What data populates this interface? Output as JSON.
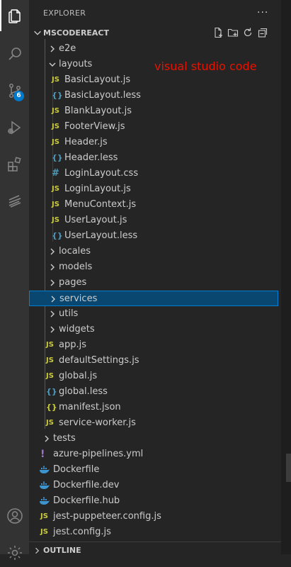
{
  "activity_bar": {
    "items": [
      {
        "name": "explorer-icon",
        "active": true
      },
      {
        "name": "search-icon"
      },
      {
        "name": "source-control-icon",
        "badge": "6"
      },
      {
        "name": "run-debug-icon"
      },
      {
        "name": "extensions-icon"
      },
      {
        "name": "remote-icon"
      },
      {
        "name": "account-icon"
      },
      {
        "name": "manage-gear-icon"
      }
    ]
  },
  "sidebar": {
    "title": "EXPLORER",
    "more": "···",
    "section": "MSCODEREACT",
    "section_actions": [
      "new-file-icon",
      "new-folder-icon",
      "refresh-icon",
      "collapse-all-icon"
    ],
    "annotation": "visual studio code",
    "outline": "OUTLINE"
  },
  "tree": [
    {
      "label": "e2e",
      "type": "folder",
      "expanded": false,
      "depth": 1
    },
    {
      "label": "layouts",
      "type": "folder",
      "expanded": true,
      "depth": 1
    },
    {
      "label": "BasicLayout.js",
      "type": "js",
      "depth": 2
    },
    {
      "label": "BasicLayout.less",
      "type": "less",
      "depth": 2
    },
    {
      "label": "BlankLayout.js",
      "type": "js",
      "depth": 2
    },
    {
      "label": "FooterView.js",
      "type": "js",
      "depth": 2
    },
    {
      "label": "Header.js",
      "type": "js",
      "depth": 2
    },
    {
      "label": "Header.less",
      "type": "less",
      "depth": 2
    },
    {
      "label": "LoginLayout.css",
      "type": "css",
      "depth": 2
    },
    {
      "label": "LoginLayout.js",
      "type": "js",
      "depth": 2
    },
    {
      "label": "MenuContext.js",
      "type": "js",
      "depth": 2
    },
    {
      "label": "UserLayout.js",
      "type": "js",
      "depth": 2
    },
    {
      "label": "UserLayout.less",
      "type": "less",
      "depth": 2
    },
    {
      "label": "locales",
      "type": "folder",
      "expanded": false,
      "depth": 1
    },
    {
      "label": "models",
      "type": "folder",
      "expanded": false,
      "depth": 1
    },
    {
      "label": "pages",
      "type": "folder",
      "expanded": false,
      "depth": 1
    },
    {
      "label": "services",
      "type": "folder",
      "expanded": false,
      "depth": 1,
      "selected": true
    },
    {
      "label": "utils",
      "type": "folder",
      "expanded": false,
      "depth": 1
    },
    {
      "label": "widgets",
      "type": "folder",
      "expanded": false,
      "depth": 1
    },
    {
      "label": "app.js",
      "type": "js",
      "depth": 1
    },
    {
      "label": "defaultSettings.js",
      "type": "js",
      "depth": 1
    },
    {
      "label": "global.js",
      "type": "js",
      "depth": 1
    },
    {
      "label": "global.less",
      "type": "less",
      "depth": 1
    },
    {
      "label": "manifest.json",
      "type": "json",
      "depth": 1
    },
    {
      "label": "service-worker.js",
      "type": "js",
      "depth": 1
    },
    {
      "label": "tests",
      "type": "folder",
      "expanded": false,
      "depth": 0
    },
    {
      "label": "azure-pipelines.yml",
      "type": "yml",
      "depth": 0
    },
    {
      "label": "Dockerfile",
      "type": "docker",
      "depth": 0
    },
    {
      "label": "Dockerfile.dev",
      "type": "docker",
      "depth": 0
    },
    {
      "label": "Dockerfile.hub",
      "type": "docker",
      "depth": 0
    },
    {
      "label": "jest-puppeteer.config.js",
      "type": "js",
      "depth": 0
    },
    {
      "label": "jest.config.js",
      "type": "js",
      "depth": 0
    }
  ],
  "file_icons": {
    "js": "JS",
    "less": "{}",
    "css": "#",
    "json": "{}",
    "yml": "!"
  },
  "colors": {
    "accent": "#007acc",
    "selection": "#094771",
    "annotation": "#e51400"
  }
}
